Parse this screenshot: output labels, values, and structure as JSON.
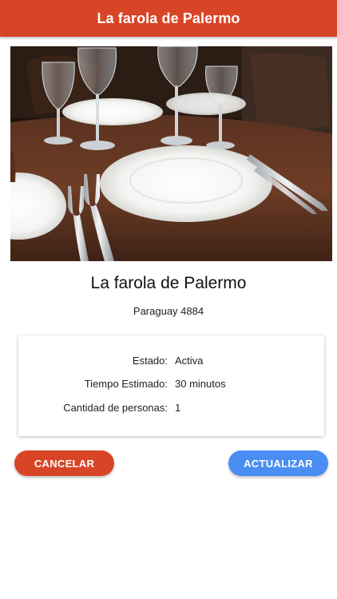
{
  "header": {
    "title": "La farola de Palermo",
    "color": "#d84526"
  },
  "restaurant": {
    "name": "La farola de Palermo",
    "address": "Paraguay 4884",
    "photo": "table-setting-photo"
  },
  "details": {
    "rows": [
      {
        "label": "Estado:",
        "value": "Activa"
      },
      {
        "label": "Tiempo Estimado:",
        "value": "30 minutos"
      },
      {
        "label": "Cantidad de personas:",
        "value": "1"
      }
    ]
  },
  "actions": {
    "cancel_label": "CANCELAR",
    "cancel_color": "#d84526",
    "update_label": "ACTUALIZAR",
    "update_color": "#4a8ef3"
  }
}
